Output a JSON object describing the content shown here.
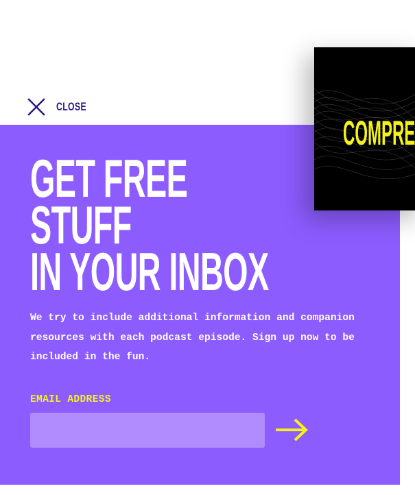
{
  "close": {
    "label": "CLOSE",
    "icon": "close-icon"
  },
  "cover": {
    "title": "COMPRES"
  },
  "signup": {
    "heading_lines": [
      "GET FREE",
      "STUFF",
      "IN YOUR INBOX"
    ],
    "description": "We try to include additional information and companion resources with each podcast episode. Sign up now to be included in the fun.",
    "email_label": "EMAIL ADDRESS",
    "email_value": "",
    "email_placeholder": "",
    "submit_icon": "arrow-right-icon"
  },
  "colors": {
    "panel": "#8c5cff",
    "input": "#b18cfe",
    "accent_yellow": "#f5f21b",
    "close_text": "#2a1580",
    "cover_bg": "#000000"
  }
}
